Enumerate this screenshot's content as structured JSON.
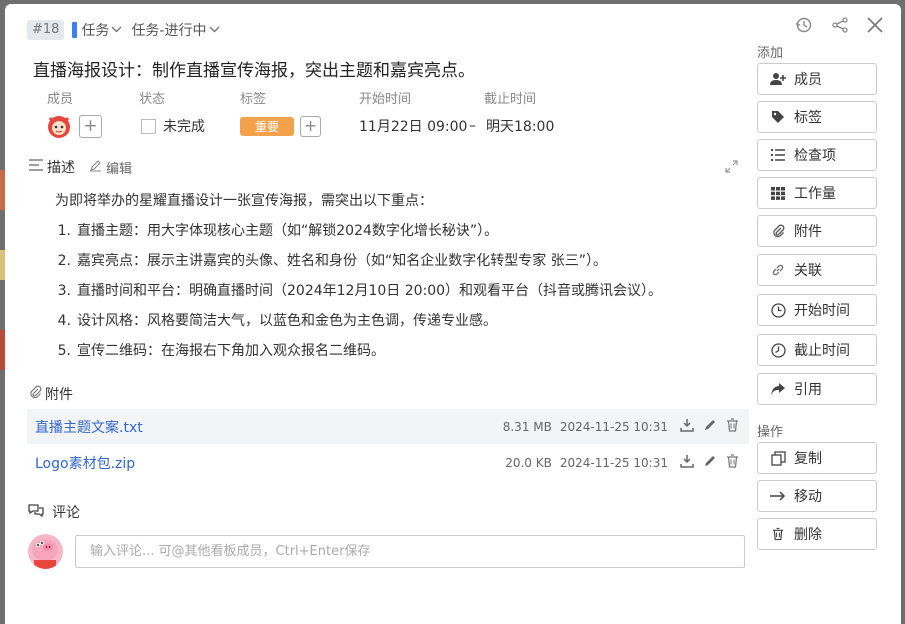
{
  "header": {
    "id_badge": "#18",
    "type_label": "任务",
    "status_label": "任务-进行中"
  },
  "title": "直播海报设计：制作直播宣传海报，突出主题和嘉宾亮点。",
  "meta": {
    "members_label": "成员",
    "status_label": "状态",
    "status_value": "未完成",
    "tags_label": "标签",
    "tag_value": "重要",
    "start_label": "开始时间",
    "start_value": "11月22日 09:00",
    "dash": "–",
    "due_label": "截止时间",
    "due_value": "明天18:00"
  },
  "description": {
    "label": "描述",
    "edit_label": "编辑",
    "intro": "为即将举办的星耀直播设计一张宣传海报，需突出以下重点：",
    "items": [
      {
        "num": "1.",
        "text": "直播主题：用大字体现核心主题（如“解锁2024数字化增长秘诀”）。"
      },
      {
        "num": "2.",
        "text": "嘉宾亮点：展示主讲嘉宾的头像、姓名和身份（如“知名企业数字化转型专家 张三”）。"
      },
      {
        "num": "3.",
        "text": "直播时间和平台：明确直播时间（2024年12月10日 20:00）和观看平台（抖音或腾讯会议）。"
      },
      {
        "num": "4.",
        "text": "设计风格：风格要简洁大气，以蓝色和金色为主色调，传递专业感。"
      },
      {
        "num": "5.",
        "text": "宣传二维码：在海报右下角加入观众报名二维码。"
      }
    ]
  },
  "attachments": {
    "label": "附件",
    "files": [
      {
        "name": "直播主题文案.txt",
        "size": "8.31 MB",
        "date": "2024-11-25 10:31"
      },
      {
        "name": "Logo素材包.zip",
        "size": "20.0 KB",
        "date": "2024-11-25 10:31"
      }
    ]
  },
  "comments": {
    "label": "评论",
    "placeholder": "输入评论... 可@其他看板成员，Ctrl+Enter保存"
  },
  "sidebar": {
    "add_title": "添加",
    "add_buttons": [
      {
        "label": "成员",
        "icon": "add-user-icon"
      },
      {
        "label": "标签",
        "icon": "tag-icon"
      },
      {
        "label": "检查项",
        "icon": "list-icon"
      },
      {
        "label": "工作量",
        "icon": "grid-icon"
      },
      {
        "label": "附件",
        "icon": "paperclip-icon"
      },
      {
        "label": "关联",
        "icon": "link-icon"
      },
      {
        "label": "开始时间",
        "icon": "clock-icon"
      },
      {
        "label": "截止时间",
        "icon": "clock-icon"
      },
      {
        "label": "引用",
        "icon": "share-arrow-icon"
      }
    ],
    "ops_title": "操作",
    "ops_buttons": [
      {
        "label": "复制",
        "icon": "copy-icon"
      },
      {
        "label": "移动",
        "icon": "arrow-right-icon"
      },
      {
        "label": "删除",
        "icon": "trash-icon"
      }
    ]
  },
  "colors": {
    "accent": "#3b7ff6",
    "tag": "#f3a24b",
    "link": "#3366cc"
  }
}
